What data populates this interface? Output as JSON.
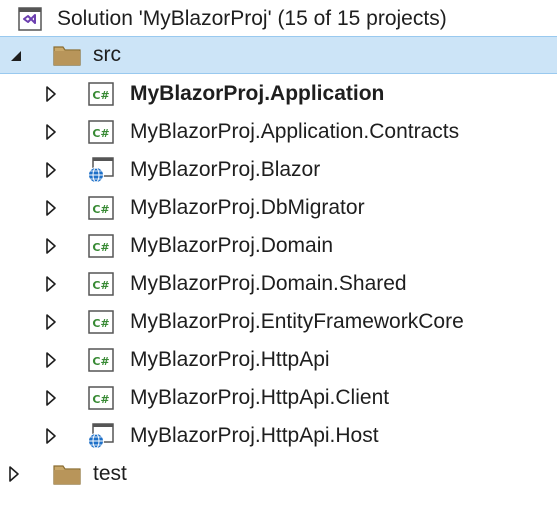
{
  "solution": {
    "label": "Solution 'MyBlazorProj' (15 of 15 projects)",
    "icon": "visual-studio-solution-icon"
  },
  "folders": [
    {
      "label": "src",
      "expanded": true,
      "projects": [
        {
          "label": "MyBlazorProj.Application",
          "icon": "csharp-project-icon",
          "startup": true
        },
        {
          "label": "MyBlazorProj.Application.Contracts",
          "icon": "csharp-project-icon"
        },
        {
          "label": "MyBlazorProj.Blazor",
          "icon": "web-project-icon"
        },
        {
          "label": "MyBlazorProj.DbMigrator",
          "icon": "csharp-project-icon"
        },
        {
          "label": "MyBlazorProj.Domain",
          "icon": "csharp-project-icon"
        },
        {
          "label": "MyBlazorProj.Domain.Shared",
          "icon": "csharp-project-icon"
        },
        {
          "label": "MyBlazorProj.EntityFrameworkCore",
          "icon": "csharp-project-icon"
        },
        {
          "label": "MyBlazorProj.HttpApi",
          "icon": "csharp-project-icon"
        },
        {
          "label": "MyBlazorProj.HttpApi.Client",
          "icon": "csharp-project-icon"
        },
        {
          "label": "MyBlazorProj.HttpApi.Host",
          "icon": "web-project-icon"
        }
      ]
    },
    {
      "label": "test",
      "expanded": false
    }
  ],
  "colors": {
    "selection": "#cce4f7",
    "folder": "#c9a86a",
    "csharp_green": "#388a34",
    "globe_blue": "#1e70c8",
    "vs_purple": "#6c3fb0"
  }
}
